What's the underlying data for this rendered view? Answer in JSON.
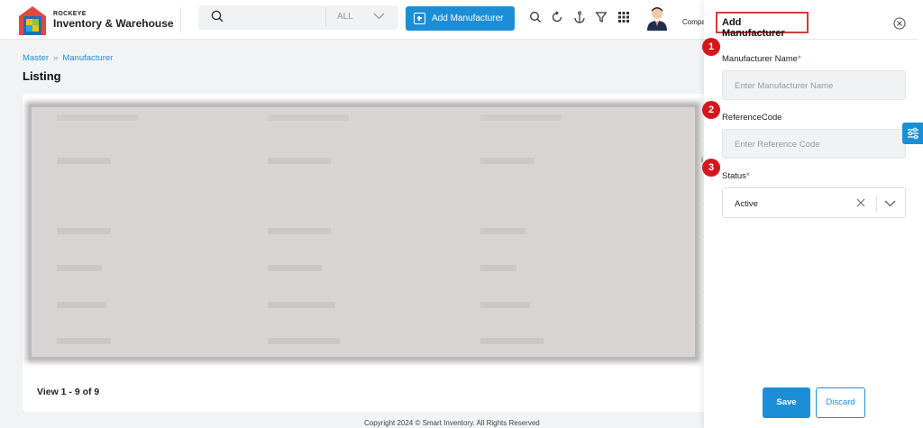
{
  "header": {
    "brand_small": "ROCKEYE",
    "brand_name": "Inventory & Warehouse",
    "search_scope": "ALL",
    "add_button_label": "Add Manufacturer",
    "company_label": "Compa",
    "icons": [
      "search-icon",
      "refresh-icon",
      "anchor-icon",
      "filter-icon",
      "apps-grid-icon"
    ]
  },
  "breadcrumb": {
    "root": "Master",
    "current": "Manufacturer"
  },
  "page_title": "Listing",
  "pagination_text": "View 1 - 9 of 9",
  "footer_text": "Copyright 2024 © Smart Inventory. All Rights Reserved",
  "panel": {
    "title": "Add Manufacturer",
    "fields": [
      {
        "badge": "1",
        "label": "Manufacturer Name",
        "required": "*",
        "placeholder": "Enter Manufacturer Name"
      },
      {
        "badge": "2",
        "label": "ReferenceCode",
        "placeholder": "Enter Reference Code"
      },
      {
        "badge": "3",
        "label": "Status",
        "required": "*",
        "value": "Active"
      }
    ],
    "save_label": "Save",
    "discard_label": "Discard"
  },
  "colors": {
    "accent": "#1c8ed6",
    "badge": "#d5161c",
    "highlight": "#d83a3a"
  }
}
